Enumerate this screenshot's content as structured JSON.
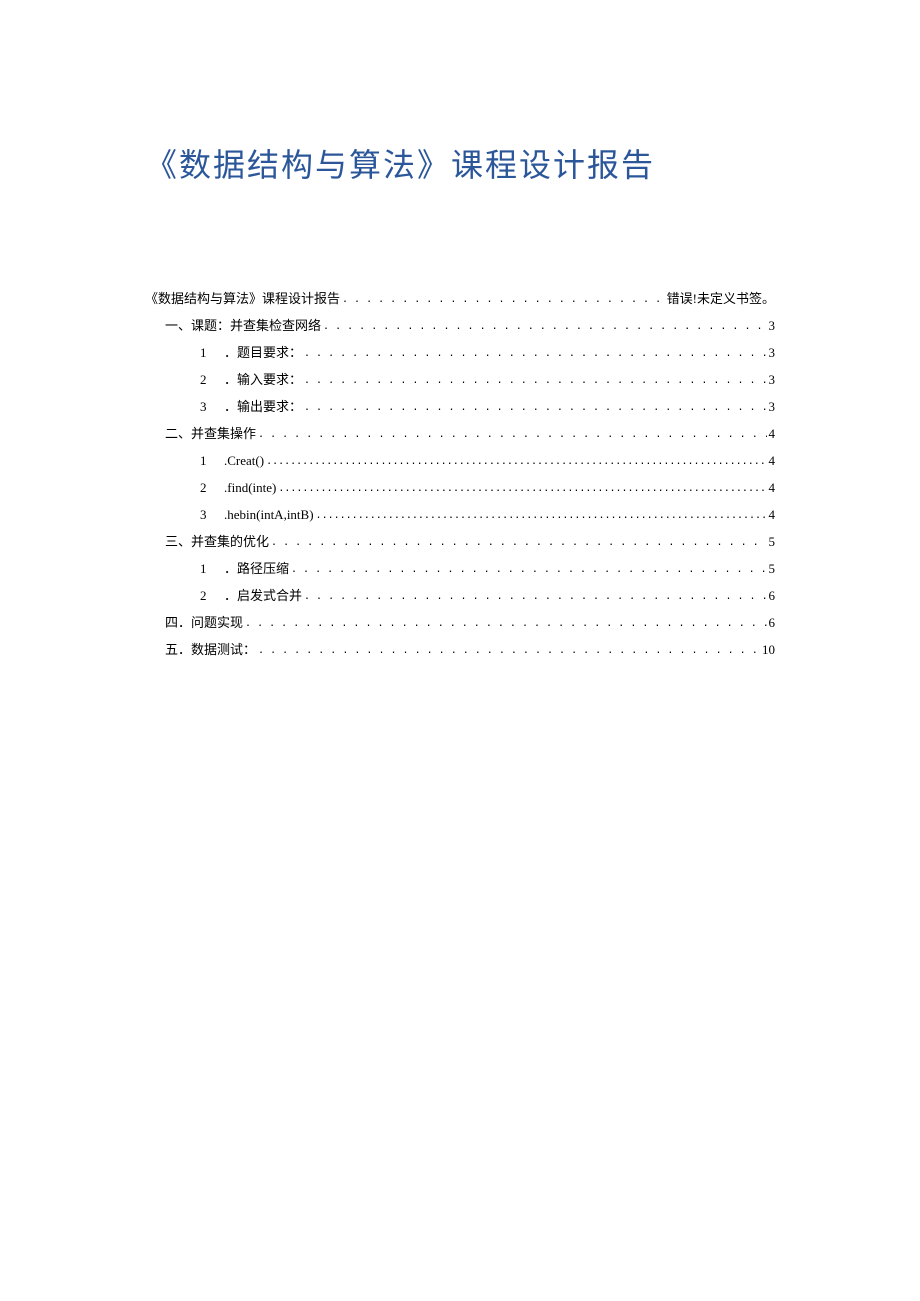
{
  "title": "《数据结构与算法》课程设计报告",
  "toc": [
    {
      "level": "0",
      "num": "",
      "label": "《数据结构与算法》课程设计报告",
      "page": "错误!未定义书签。",
      "dotStyle": "normal"
    },
    {
      "level": "1",
      "num": "一、",
      "label": "课题：并查集检查网络",
      "page": "3",
      "dotStyle": "normal"
    },
    {
      "level": "2",
      "num": "1",
      "label": "．题目要求：",
      "page": "3",
      "dotStyle": "normal"
    },
    {
      "level": "2",
      "num": "2",
      "label": "．输入要求：",
      "page": "3",
      "dotStyle": "normal"
    },
    {
      "level": "2",
      "num": "3",
      "label": "．输出要求：",
      "page": "3",
      "dotStyle": "normal"
    },
    {
      "level": "1",
      "num": "二、",
      "label": "并查集操作",
      "page": "4",
      "dotStyle": "normal"
    },
    {
      "level": "2",
      "num": "1",
      "label": ".Creat()",
      "page": "4",
      "dotStyle": "thin"
    },
    {
      "level": "2",
      "num": "2",
      "label": ".find(inte)",
      "page": "4",
      "dotStyle": "thin"
    },
    {
      "level": "2",
      "num": "3",
      "label": ".hebin(intA,intB)",
      "page": "4",
      "dotStyle": "thin"
    },
    {
      "level": "1",
      "num": "三、",
      "label": "并查集的优化",
      "page": "5",
      "dotStyle": "normal"
    },
    {
      "level": "2",
      "num": "1",
      "label": "．路径压缩",
      "page": "5",
      "dotStyle": "normal"
    },
    {
      "level": "2",
      "num": "2",
      "label": "．启发式合并",
      "page": "6",
      "dotStyle": "normal"
    },
    {
      "level": "1b",
      "num": "四",
      "label": "．问题实现",
      "page": "6",
      "dotStyle": "normal"
    },
    {
      "level": "1b",
      "num": "五",
      "label": "．数据测试：",
      "page": "10",
      "dotStyle": "normal"
    }
  ],
  "dotsNormal": ". . . . . . . . . . . . . . . . . . . . . . . . . . . . . . . . . . . . . . . . . . . . . . . . . . . . . . . . . . . . . . . . . . . . . . . . . . . . . . . . . . . . . . . . . . . . . . . . . . . . . . . . . . . . . . . . . .",
  "dotsThin": "...................................................................................................................................................................................................................................."
}
